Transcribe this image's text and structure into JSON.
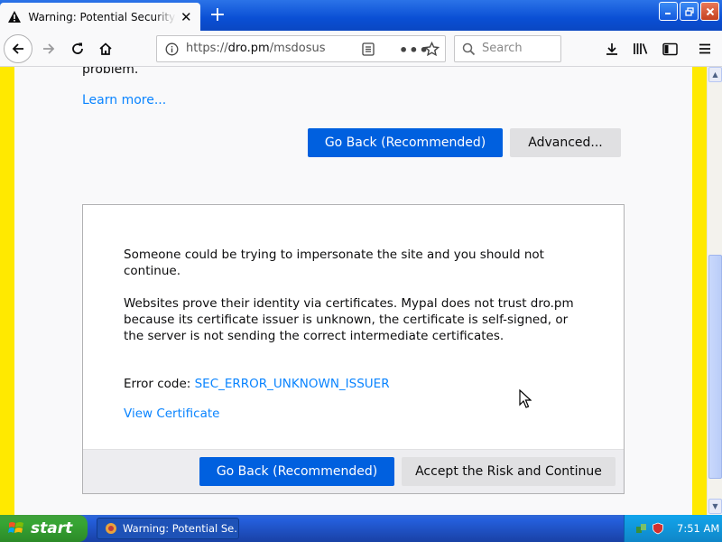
{
  "browser": {
    "tab_title": "Warning: Potential Security Risk Ahead",
    "url_prefix": "https://",
    "url_domain": "dro.pm",
    "url_path": "/msdosus",
    "search_placeholder": "Search"
  },
  "page": {
    "problem_text": "problem.",
    "learn_more": "Learn more...",
    "go_back_label": "Go Back (Recommended)",
    "advanced_label": "Advanced...",
    "impersonate_text": "Someone could be trying to impersonate the site and you should not continue.",
    "certificates_text": "Websites prove their identity via certificates. Mypal does not trust dro.pm because its certificate issuer is unknown, the certificate is self-signed, or the server is not sending the correct intermediate certificates.",
    "error_code_label": "Error code: ",
    "error_code": "SEC_ERROR_UNKNOWN_ISSUER",
    "view_certificate": "View Certificate",
    "accept_label": "Accept the Risk and Continue"
  },
  "taskbar": {
    "start_label": "start",
    "task_label": "Warning: Potential Se...",
    "clock": "7:51 AM"
  },
  "colors": {
    "primary_button": "#0060df",
    "link": "#0a84ff",
    "stripe": "#ffe900"
  }
}
